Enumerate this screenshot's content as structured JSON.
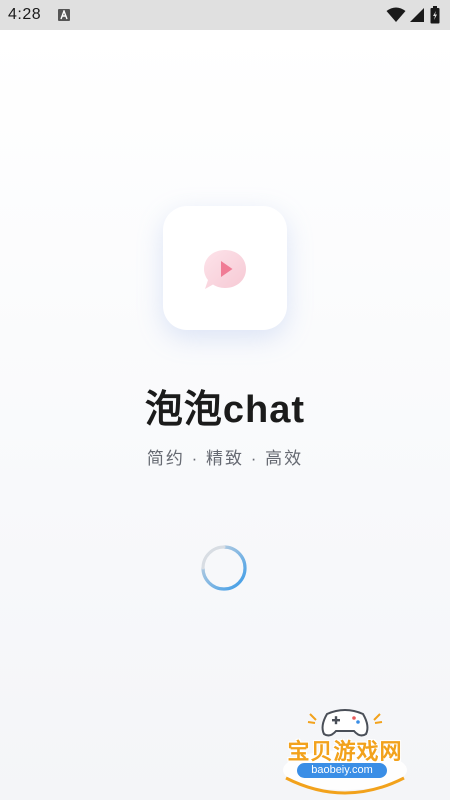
{
  "status_bar": {
    "time": "4:28",
    "icons": [
      "a-notification-icon",
      "wifi-icon",
      "signal-icon",
      "battery-icon"
    ]
  },
  "app": {
    "name": "泡泡chat",
    "slogan": "简约 · 精致 · 高效",
    "logo_icon": "chat-bubble-play-icon"
  },
  "loading": {
    "indicator": "spinner-icon",
    "accent": "#3a9be8"
  },
  "watermark": {
    "title": "宝贝游戏网",
    "url": "baobeiy.com"
  },
  "colors": {
    "status_bar_bg": "#e0e0e0",
    "logo_accent": "#f07c95",
    "watermark_orange": "#f2a21c",
    "watermark_blue": "#3a8ee6"
  }
}
